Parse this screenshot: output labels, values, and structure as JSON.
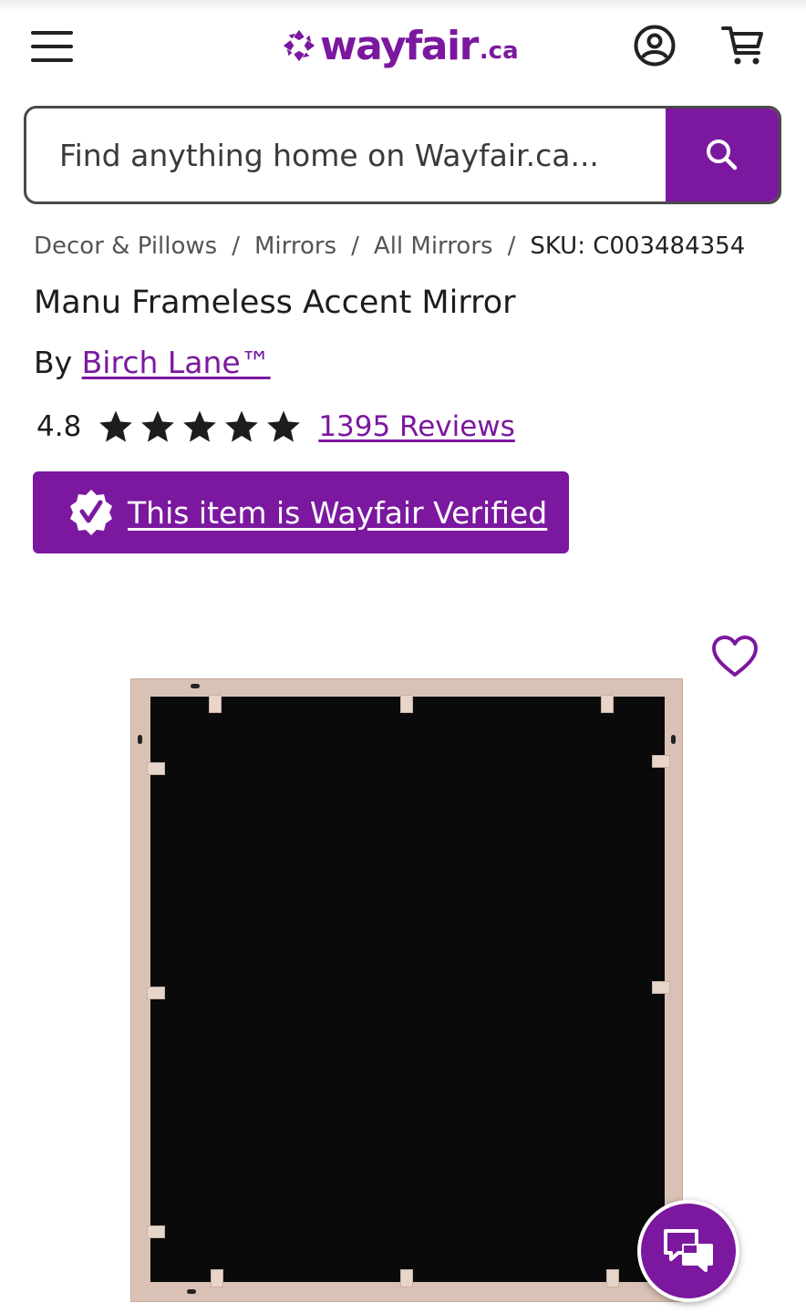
{
  "header": {
    "logo_text": "wayfair",
    "logo_tld": ".ca",
    "brand_color": "#7b189f",
    "icons": [
      "hamburger-menu-icon",
      "wayfair-logo-icon",
      "account-icon",
      "cart-icon"
    ]
  },
  "search": {
    "placeholder": "Find anything home on Wayfair.ca...",
    "icon": "search-icon"
  },
  "breadcrumb": {
    "items": [
      "Decor & Pillows",
      "Mirrors",
      "All Mirrors"
    ],
    "separator": "/",
    "sku": "SKU: C003484354"
  },
  "product": {
    "title": "Manu Frameless Accent Mirror",
    "by_label": "By",
    "brand": "Birch Lane™",
    "rating_value": "4.8",
    "rating_stars": 5,
    "reviews_label": "1395 Reviews",
    "verified_label": "This item is Wayfair Verified",
    "verified_icon": "verified-badge-icon",
    "favorite_icon": "heart-icon",
    "image": "mirror-back-photo"
  },
  "chat": {
    "icon": "chat-bubbles-icon"
  }
}
